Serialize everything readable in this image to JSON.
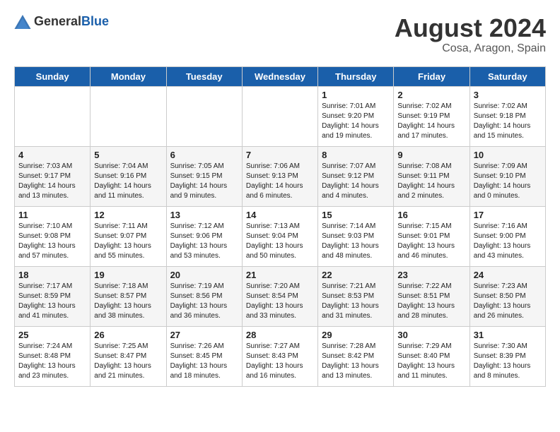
{
  "header": {
    "logo_general": "General",
    "logo_blue": "Blue",
    "month_year": "August 2024",
    "location": "Cosa, Aragon, Spain"
  },
  "days_of_week": [
    "Sunday",
    "Monday",
    "Tuesday",
    "Wednesday",
    "Thursday",
    "Friday",
    "Saturday"
  ],
  "weeks": [
    [
      {
        "day": "",
        "info": ""
      },
      {
        "day": "",
        "info": ""
      },
      {
        "day": "",
        "info": ""
      },
      {
        "day": "",
        "info": ""
      },
      {
        "day": "1",
        "info": "Sunrise: 7:01 AM\nSunset: 9:20 PM\nDaylight: 14 hours\nand 19 minutes."
      },
      {
        "day": "2",
        "info": "Sunrise: 7:02 AM\nSunset: 9:19 PM\nDaylight: 14 hours\nand 17 minutes."
      },
      {
        "day": "3",
        "info": "Sunrise: 7:02 AM\nSunset: 9:18 PM\nDaylight: 14 hours\nand 15 minutes."
      }
    ],
    [
      {
        "day": "4",
        "info": "Sunrise: 7:03 AM\nSunset: 9:17 PM\nDaylight: 14 hours\nand 13 minutes."
      },
      {
        "day": "5",
        "info": "Sunrise: 7:04 AM\nSunset: 9:16 PM\nDaylight: 14 hours\nand 11 minutes."
      },
      {
        "day": "6",
        "info": "Sunrise: 7:05 AM\nSunset: 9:15 PM\nDaylight: 14 hours\nand 9 minutes."
      },
      {
        "day": "7",
        "info": "Sunrise: 7:06 AM\nSunset: 9:13 PM\nDaylight: 14 hours\nand 6 minutes."
      },
      {
        "day": "8",
        "info": "Sunrise: 7:07 AM\nSunset: 9:12 PM\nDaylight: 14 hours\nand 4 minutes."
      },
      {
        "day": "9",
        "info": "Sunrise: 7:08 AM\nSunset: 9:11 PM\nDaylight: 14 hours\nand 2 minutes."
      },
      {
        "day": "10",
        "info": "Sunrise: 7:09 AM\nSunset: 9:10 PM\nDaylight: 14 hours\nand 0 minutes."
      }
    ],
    [
      {
        "day": "11",
        "info": "Sunrise: 7:10 AM\nSunset: 9:08 PM\nDaylight: 13 hours\nand 57 minutes."
      },
      {
        "day": "12",
        "info": "Sunrise: 7:11 AM\nSunset: 9:07 PM\nDaylight: 13 hours\nand 55 minutes."
      },
      {
        "day": "13",
        "info": "Sunrise: 7:12 AM\nSunset: 9:06 PM\nDaylight: 13 hours\nand 53 minutes."
      },
      {
        "day": "14",
        "info": "Sunrise: 7:13 AM\nSunset: 9:04 PM\nDaylight: 13 hours\nand 50 minutes."
      },
      {
        "day": "15",
        "info": "Sunrise: 7:14 AM\nSunset: 9:03 PM\nDaylight: 13 hours\nand 48 minutes."
      },
      {
        "day": "16",
        "info": "Sunrise: 7:15 AM\nSunset: 9:01 PM\nDaylight: 13 hours\nand 46 minutes."
      },
      {
        "day": "17",
        "info": "Sunrise: 7:16 AM\nSunset: 9:00 PM\nDaylight: 13 hours\nand 43 minutes."
      }
    ],
    [
      {
        "day": "18",
        "info": "Sunrise: 7:17 AM\nSunset: 8:59 PM\nDaylight: 13 hours\nand 41 minutes."
      },
      {
        "day": "19",
        "info": "Sunrise: 7:18 AM\nSunset: 8:57 PM\nDaylight: 13 hours\nand 38 minutes."
      },
      {
        "day": "20",
        "info": "Sunrise: 7:19 AM\nSunset: 8:56 PM\nDaylight: 13 hours\nand 36 minutes."
      },
      {
        "day": "21",
        "info": "Sunrise: 7:20 AM\nSunset: 8:54 PM\nDaylight: 13 hours\nand 33 minutes."
      },
      {
        "day": "22",
        "info": "Sunrise: 7:21 AM\nSunset: 8:53 PM\nDaylight: 13 hours\nand 31 minutes."
      },
      {
        "day": "23",
        "info": "Sunrise: 7:22 AM\nSunset: 8:51 PM\nDaylight: 13 hours\nand 28 minutes."
      },
      {
        "day": "24",
        "info": "Sunrise: 7:23 AM\nSunset: 8:50 PM\nDaylight: 13 hours\nand 26 minutes."
      }
    ],
    [
      {
        "day": "25",
        "info": "Sunrise: 7:24 AM\nSunset: 8:48 PM\nDaylight: 13 hours\nand 23 minutes."
      },
      {
        "day": "26",
        "info": "Sunrise: 7:25 AM\nSunset: 8:47 PM\nDaylight: 13 hours\nand 21 minutes."
      },
      {
        "day": "27",
        "info": "Sunrise: 7:26 AM\nSunset: 8:45 PM\nDaylight: 13 hours\nand 18 minutes."
      },
      {
        "day": "28",
        "info": "Sunrise: 7:27 AM\nSunset: 8:43 PM\nDaylight: 13 hours\nand 16 minutes."
      },
      {
        "day": "29",
        "info": "Sunrise: 7:28 AM\nSunset: 8:42 PM\nDaylight: 13 hours\nand 13 minutes."
      },
      {
        "day": "30",
        "info": "Sunrise: 7:29 AM\nSunset: 8:40 PM\nDaylight: 13 hours\nand 11 minutes."
      },
      {
        "day": "31",
        "info": "Sunrise: 7:30 AM\nSunset: 8:39 PM\nDaylight: 13 hours\nand 8 minutes."
      }
    ]
  ]
}
